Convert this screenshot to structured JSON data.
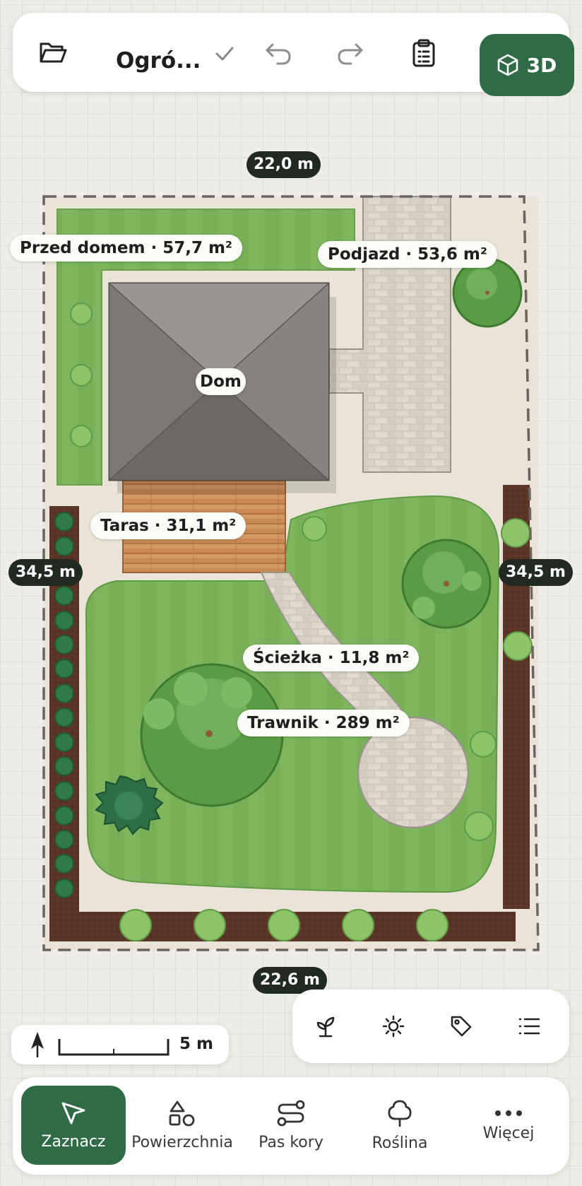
{
  "topbar": {
    "title": "Ogró...",
    "icons": [
      "folder-open-icon",
      "check-icon",
      "undo-icon",
      "redo-icon",
      "clipboard-list-icon"
    ],
    "btn3d_label": "3D",
    "btn3d_icon": "cube-icon"
  },
  "plan": {
    "areas": {
      "front": "Przed domem · 57,7 m²",
      "driveway": "Podjazd · 53,6 m²",
      "house": "Dom",
      "terrace": "Taras · 31,1 m²",
      "path": "Ścieżka · 11,8 m²",
      "lawn": "Trawnik · 289 m²"
    },
    "dimensions": {
      "top": "22,0 m",
      "bottom": "22,6 m",
      "left": "34,5 m",
      "right": "34,5 m"
    }
  },
  "scale": {
    "value": "5 m",
    "icon": "north-arrow-icon"
  },
  "tools": [
    {
      "icon": "sprout-icon"
    },
    {
      "icon": "sun-icon"
    },
    {
      "icon": "tag-icon"
    },
    {
      "icon": "list-icon"
    }
  ],
  "bottom_nav": [
    {
      "label": "Zaznacz",
      "icon": "cursor-icon",
      "active": true
    },
    {
      "label": "Powierzchnia",
      "icon": "shapes-icon",
      "active": false
    },
    {
      "label": "Pas kory",
      "icon": "path-icon",
      "active": false
    },
    {
      "label": "Roślina",
      "icon": "tree-icon",
      "active": false
    },
    {
      "label": "Więcej",
      "icon": "more-icon",
      "active": false
    }
  ],
  "colors": {
    "accent": "#2e6b46",
    "lawn": "#79b35a",
    "front_lawn": "#82bb5f",
    "mulch": "#5a3424",
    "deck": "#c98a56",
    "pavers": "#c9c3b8",
    "roof": "#807975",
    "ground": "#e9e4d7"
  }
}
